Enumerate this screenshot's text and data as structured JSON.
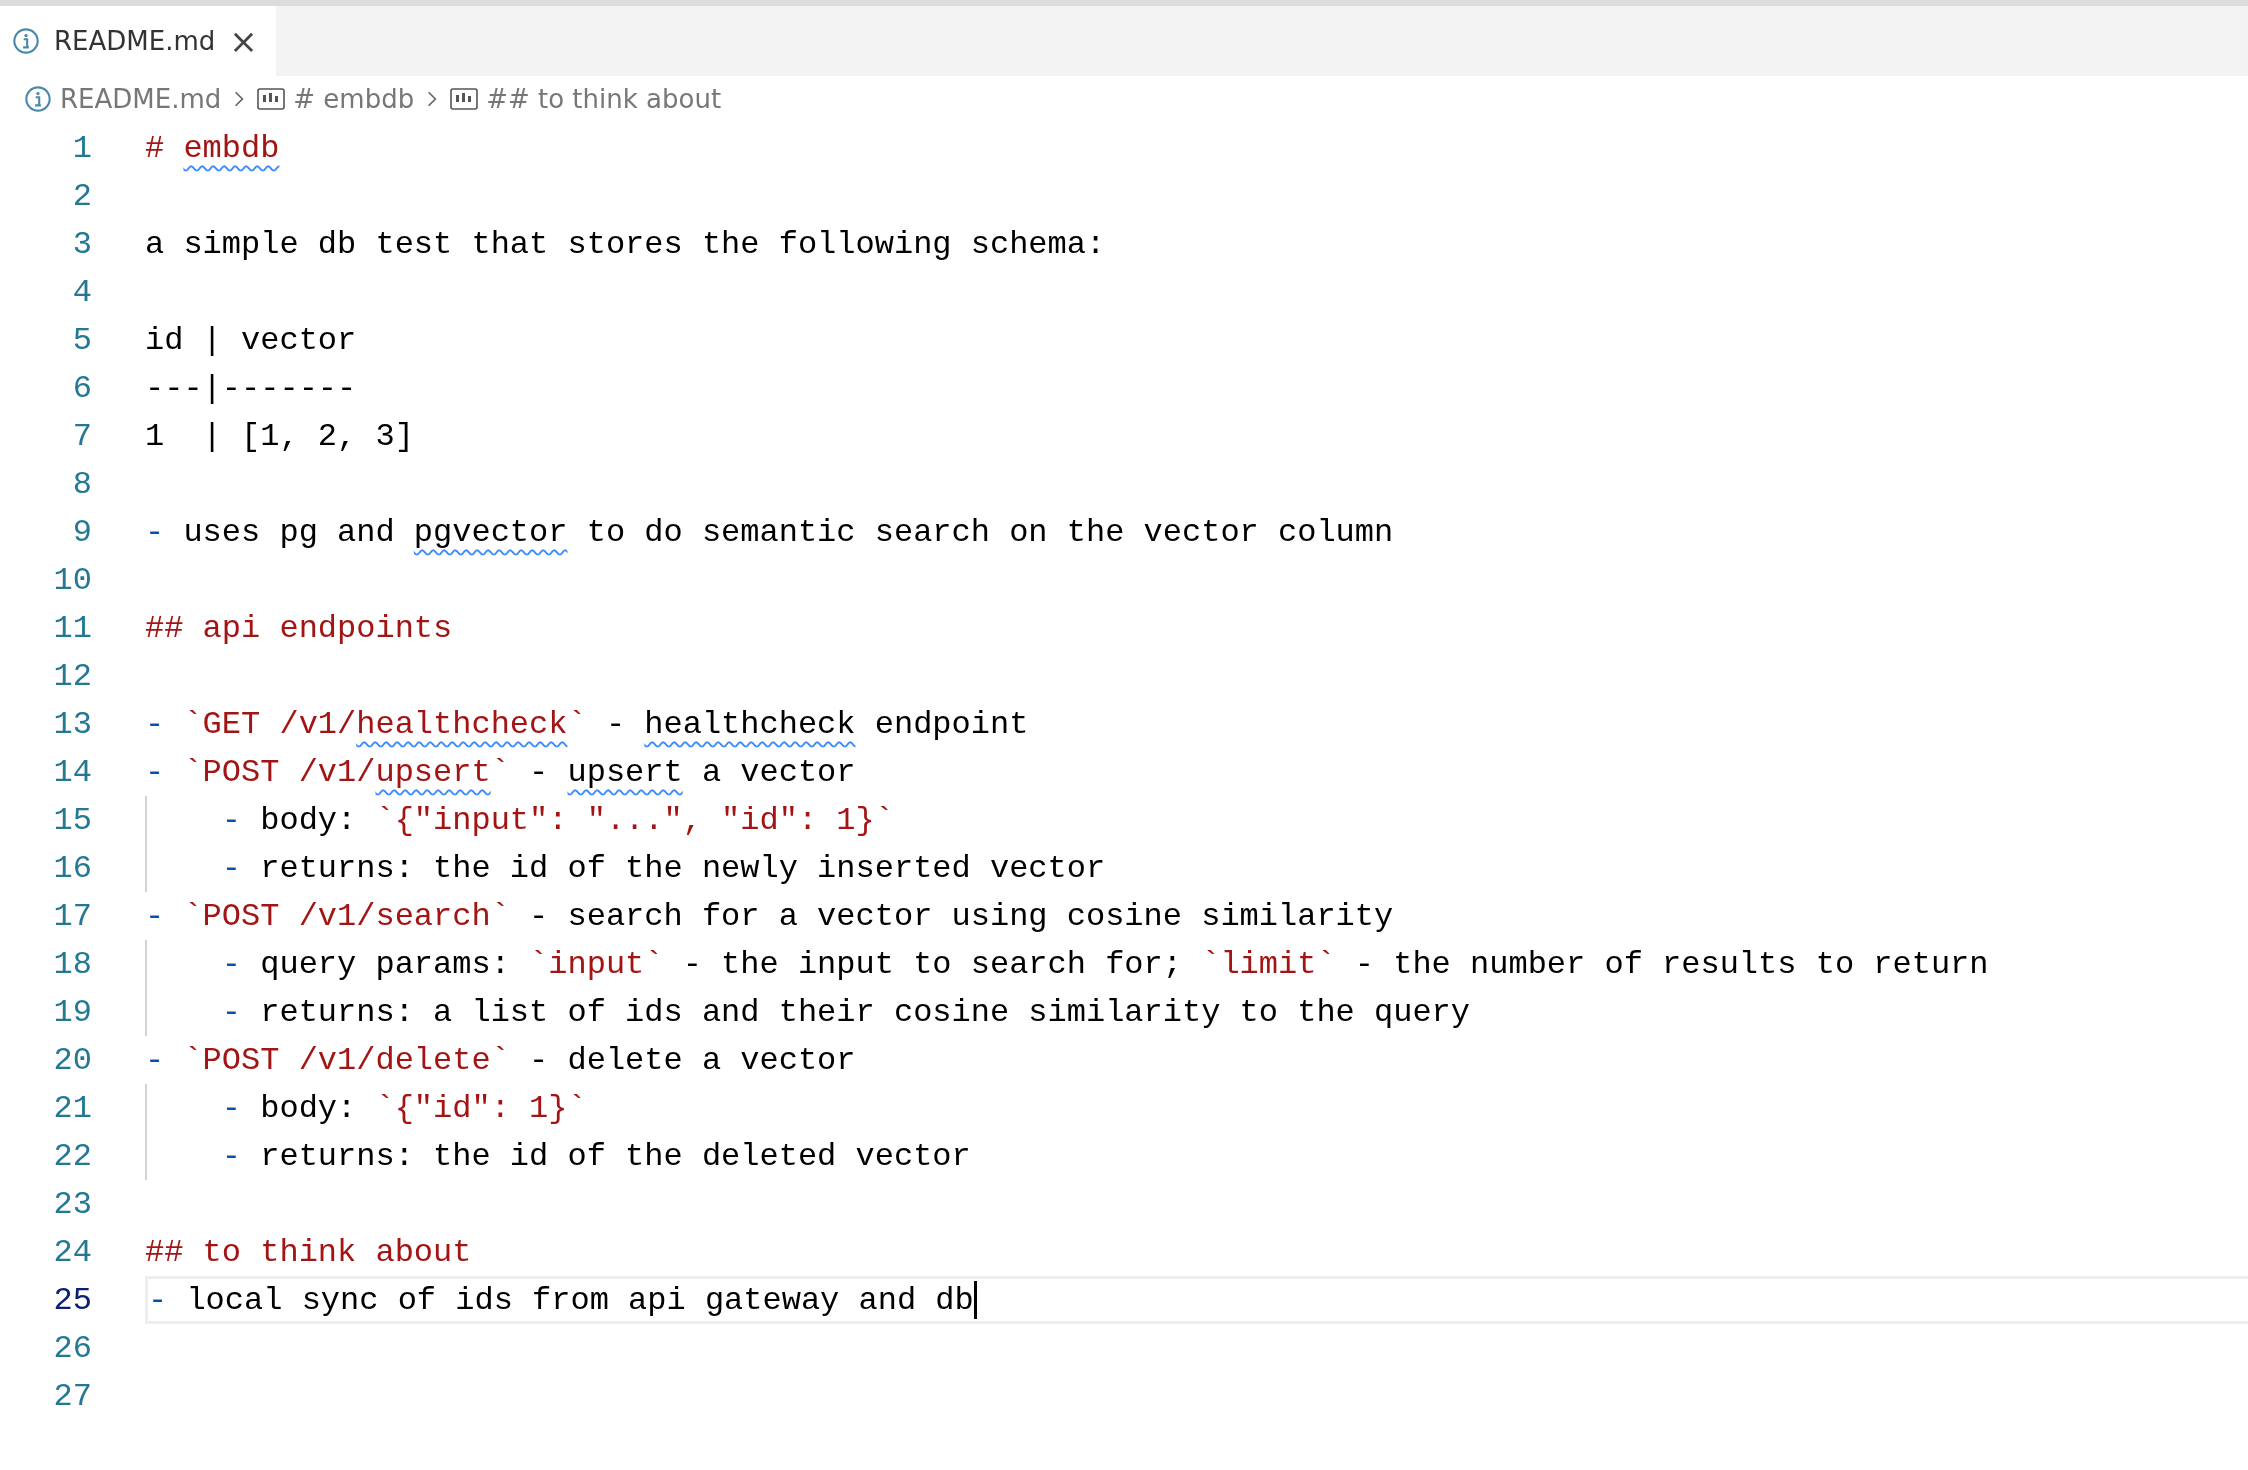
{
  "tabs": [
    {
      "label": "README.md",
      "close": "×",
      "selected": true
    }
  ],
  "breadcrumb": [
    {
      "kind": "file",
      "label": "README.md"
    },
    {
      "kind": "symbol",
      "label": "# embdb"
    },
    {
      "kind": "symbol",
      "label": "## to think about"
    }
  ],
  "lines": [
    {
      "number": "1",
      "current": false,
      "indented": false,
      "tokens": [
        {
          "kind": "heading",
          "text": "# "
        },
        {
          "kind": "heading",
          "text": "embdb",
          "misspelled": true
        }
      ]
    },
    {
      "number": "2",
      "current": false,
      "indented": false
    },
    {
      "number": "3",
      "current": false,
      "indented": false,
      "tokens": [
        {
          "kind": "text",
          "text": "a simple db test that stores the following schema:"
        }
      ]
    },
    {
      "number": "4",
      "current": false,
      "indented": false
    },
    {
      "number": "5",
      "current": false,
      "indented": false,
      "tokens": [
        {
          "kind": "text",
          "text": "id | vector"
        }
      ]
    },
    {
      "number": "6",
      "current": false,
      "indented": false,
      "tokens": [
        {
          "kind": "text",
          "text": "---|-------"
        }
      ]
    },
    {
      "number": "7",
      "current": false,
      "indented": false,
      "tokens": [
        {
          "kind": "text",
          "text": "1  | [1, 2, 3]"
        }
      ]
    },
    {
      "number": "8",
      "current": false,
      "indented": false
    },
    {
      "number": "9",
      "current": false,
      "indented": false,
      "tokens": [
        {
          "kind": "bullet",
          "text": "- "
        },
        {
          "kind": "text",
          "text": "uses pg and "
        },
        {
          "kind": "text",
          "text": "pgvector",
          "misspelled": true
        },
        {
          "kind": "text",
          "text": " to do semantic search on the vector column"
        }
      ]
    },
    {
      "number": "10",
      "current": false,
      "indented": false
    },
    {
      "number": "11",
      "current": false,
      "indented": false,
      "tokens": [
        {
          "kind": "heading",
          "text": "## api endpoints"
        }
      ]
    },
    {
      "number": "12",
      "current": false,
      "indented": false
    },
    {
      "number": "13",
      "current": false,
      "indented": false,
      "tokens": [
        {
          "kind": "bullet",
          "text": "- "
        },
        {
          "kind": "code",
          "text": "`GET /v1/"
        },
        {
          "kind": "code",
          "text": "healthcheck",
          "misspelled": true
        },
        {
          "kind": "code",
          "text": "`"
        },
        {
          "kind": "text",
          "text": " - "
        },
        {
          "kind": "text",
          "text": "healthcheck",
          "misspelled": true
        },
        {
          "kind": "text",
          "text": " endpoint"
        }
      ]
    },
    {
      "number": "14",
      "current": false,
      "indented": false,
      "tokens": [
        {
          "kind": "bullet",
          "text": "- "
        },
        {
          "kind": "code",
          "text": "`POST /v1/"
        },
        {
          "kind": "code",
          "text": "upsert",
          "misspelled": true
        },
        {
          "kind": "code",
          "text": "`"
        },
        {
          "kind": "text",
          "text": " - "
        },
        {
          "kind": "text",
          "text": "upsert",
          "misspelled": true
        },
        {
          "kind": "text",
          "text": " a vector"
        }
      ]
    },
    {
      "number": "15",
      "current": false,
      "indented": true,
      "tokens": [
        {
          "kind": "bullet",
          "text": "- "
        },
        {
          "kind": "text",
          "text": "body: "
        },
        {
          "kind": "code",
          "text": "`{\"input\": \"...\", \"id\": 1}`"
        }
      ]
    },
    {
      "number": "16",
      "current": false,
      "indented": true,
      "tokens": [
        {
          "kind": "bullet",
          "text": "- "
        },
        {
          "kind": "text",
          "text": "returns: the id of the newly inserted vector"
        }
      ]
    },
    {
      "number": "17",
      "current": false,
      "indented": false,
      "tokens": [
        {
          "kind": "bullet",
          "text": "- "
        },
        {
          "kind": "code",
          "text": "`POST /v1/search`"
        },
        {
          "kind": "text",
          "text": " - search for a vector using cosine similarity"
        }
      ]
    },
    {
      "number": "18",
      "current": false,
      "indented": true,
      "tokens": [
        {
          "kind": "bullet",
          "text": "- "
        },
        {
          "kind": "text",
          "text": "query params: "
        },
        {
          "kind": "code",
          "text": "`input`"
        },
        {
          "kind": "text",
          "text": " - the input to search for; "
        },
        {
          "kind": "code",
          "text": "`limit`"
        },
        {
          "kind": "text",
          "text": " - the number of results to return"
        }
      ]
    },
    {
      "number": "19",
      "current": false,
      "indented": true,
      "tokens": [
        {
          "kind": "bullet",
          "text": "- "
        },
        {
          "kind": "text",
          "text": "returns: a list of ids and their cosine similarity to the query"
        }
      ]
    },
    {
      "number": "20",
      "current": false,
      "indented": false,
      "tokens": [
        {
          "kind": "bullet",
          "text": "- "
        },
        {
          "kind": "code",
          "text": "`POST /v1/delete`"
        },
        {
          "kind": "text",
          "text": " - delete a vector"
        }
      ]
    },
    {
      "number": "21",
      "current": false,
      "indented": true,
      "tokens": [
        {
          "kind": "bullet",
          "text": "- "
        },
        {
          "kind": "text",
          "text": "body: "
        },
        {
          "kind": "code",
          "text": "`{\"id\": 1}`"
        }
      ]
    },
    {
      "number": "22",
      "current": false,
      "indented": true,
      "tokens": [
        {
          "kind": "bullet",
          "text": "- "
        },
        {
          "kind": "text",
          "text": "returns: the id of the deleted vector"
        }
      ]
    },
    {
      "number": "23",
      "current": false,
      "indented": false
    },
    {
      "number": "24",
      "current": false,
      "indented": false,
      "tokens": [
        {
          "kind": "heading",
          "text": "## to think about"
        }
      ]
    },
    {
      "number": "25",
      "current": true,
      "indented": false,
      "tokens": [
        {
          "kind": "bullet",
          "text": "- "
        },
        {
          "kind": "text",
          "text": "local sync of ids from api gateway and db"
        }
      ]
    },
    {
      "number": "26",
      "current": false,
      "indented": false
    },
    {
      "number": "27",
      "current": false,
      "indented": false
    }
  ]
}
